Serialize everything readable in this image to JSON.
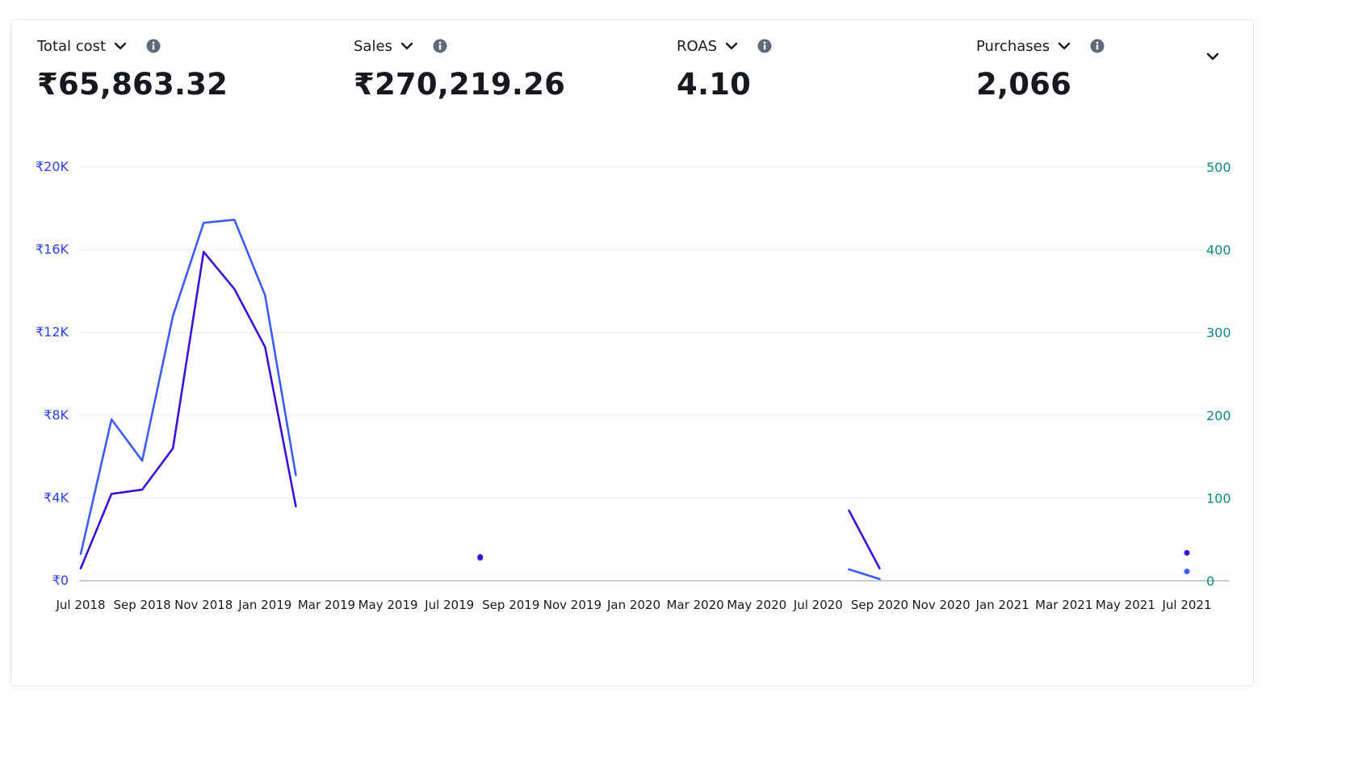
{
  "metrics": [
    {
      "label": "Total cost",
      "value": "₹65,863.32"
    },
    {
      "label": "Sales",
      "value": "₹270,219.26"
    },
    {
      "label": "ROAS",
      "value": "4.10"
    },
    {
      "label": "Purchases",
      "value": "2,066"
    }
  ],
  "icons": {
    "dropdown": "chevron-down-icon",
    "info": "info-icon",
    "collapse": "chevron-down-icon"
  },
  "chart_data": {
    "type": "line",
    "x_ticks": [
      "Jul 2018",
      "Sep 2018",
      "Nov 2018",
      "Jan 2019",
      "Mar 2019",
      "May 2019",
      "Jul 2019",
      "Sep 2019",
      "Nov 2019",
      "Jan 2020",
      "Mar 2020",
      "May 2020",
      "Jul 2020",
      "Sep 2020",
      "Nov 2020",
      "Jan 2021",
      "Mar 2021",
      "May 2021",
      "Jul 2021"
    ],
    "x_range": [
      "2018-07",
      "2021-07"
    ],
    "y_left": {
      "ticks": [
        "₹0",
        "₹4K",
        "₹8K",
        "₹12K",
        "₹16K",
        "₹20K"
      ],
      "min": 0,
      "max": 20000
    },
    "y_right": {
      "ticks": [
        "0",
        "100",
        "200",
        "300",
        "400",
        "500"
      ],
      "min": 0,
      "max": 500
    },
    "grid": true,
    "colors": {
      "series_a": "#3d5cf5",
      "series_b": "#3a11d6",
      "left_axis": "#2b3ff5",
      "right_axis": "#0f8a83"
    },
    "series": [
      {
        "color": "#3d5cf5",
        "segments": [
          [
            [
              "2018-07",
              1300
            ],
            [
              "2018-08",
              7800
            ],
            [
              "2018-09",
              5800
            ],
            [
              "2018-10",
              12800
            ],
            [
              "2018-11",
              17300
            ],
            [
              "2018-12",
              17450
            ],
            [
              "2019-01",
              13800
            ],
            [
              "2019-02",
              5100
            ]
          ],
          [
            [
              "2019-08",
              1100
            ]
          ],
          [
            [
              "2020-08",
              550
            ],
            [
              "2020-09",
              80
            ]
          ],
          [
            [
              "2021-07",
              450
            ]
          ]
        ]
      },
      {
        "color": "#3a11d6",
        "segments": [
          [
            [
              "2018-07",
              600
            ],
            [
              "2018-08",
              4200
            ],
            [
              "2018-09",
              4400
            ],
            [
              "2018-10",
              6400
            ],
            [
              "2018-11",
              15900
            ],
            [
              "2018-12",
              14100
            ],
            [
              "2019-01",
              11300
            ],
            [
              "2019-02",
              3600
            ]
          ],
          [
            [
              "2019-08",
              1150
            ]
          ],
          [
            [
              "2020-08",
              3400
            ],
            [
              "2020-09",
              600
            ]
          ],
          [
            [
              "2021-07",
              1350
            ]
          ]
        ]
      }
    ]
  }
}
